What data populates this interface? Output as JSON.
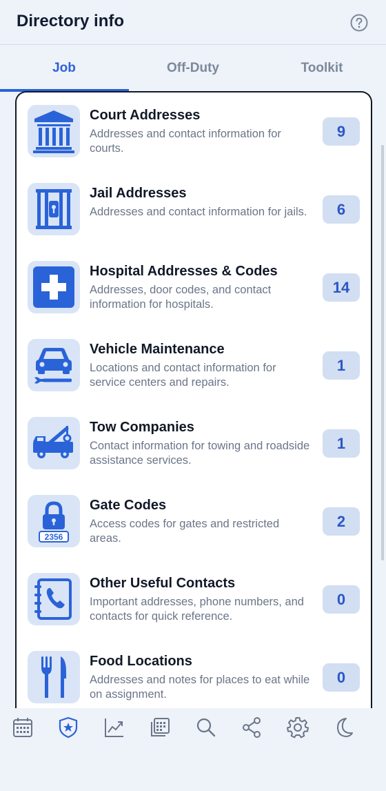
{
  "header": {
    "title": "Directory info",
    "help_icon": "help-circle-icon"
  },
  "tabs": [
    {
      "label": "Job",
      "active": true
    },
    {
      "label": "Off-Duty",
      "active": false
    },
    {
      "label": "Toolkit",
      "active": false
    }
  ],
  "colors": {
    "accent": "#2a63d8",
    "icon_bg": "#d9e4f6",
    "badge_bg": "#d2def2",
    "badge_text": "#2a57c6"
  },
  "items": [
    {
      "title": "Court Addresses",
      "description": "Addresses and contact information for courts.",
      "count": "9",
      "icon": "courthouse-icon"
    },
    {
      "title": "Jail Addresses",
      "description": "Addresses and contact information for jails.",
      "count": "6",
      "icon": "jail-cell-icon"
    },
    {
      "title": "Hospital Addresses & Codes",
      "description": "Addresses, door codes, and contact information for hospitals.",
      "count": "14",
      "icon": "medical-cross-icon"
    },
    {
      "title": "Vehicle Maintenance",
      "description": "Locations and contact information for service centers and repairs.",
      "count": "1",
      "icon": "car-wrench-icon"
    },
    {
      "title": "Tow Companies",
      "description": "Contact information for towing and roadside assistance services.",
      "count": "1",
      "icon": "tow-truck-icon"
    },
    {
      "title": "Gate Codes",
      "description": "Access codes for gates and restricted areas.",
      "count": "2",
      "icon": "padlock-code-icon",
      "icon_text": "2356"
    },
    {
      "title": "Other Useful Contacts",
      "description": "Important addresses, phone numbers, and contacts for quick reference.",
      "count": "0",
      "icon": "phone-book-icon"
    },
    {
      "title": "Food Locations",
      "description": "Addresses and notes for places to eat while on assignment.",
      "count": "0",
      "icon": "fork-knife-icon"
    }
  ],
  "bottom_nav": [
    {
      "icon": "calendar-icon",
      "active": false
    },
    {
      "icon": "badge-star-icon",
      "active": true
    },
    {
      "icon": "trend-chart-icon",
      "active": false
    },
    {
      "icon": "calendar-stack-icon",
      "active": false
    },
    {
      "icon": "search-icon",
      "active": false
    },
    {
      "icon": "share-icon",
      "active": false
    },
    {
      "icon": "gear-icon",
      "active": false
    },
    {
      "icon": "moon-icon",
      "active": false
    }
  ]
}
